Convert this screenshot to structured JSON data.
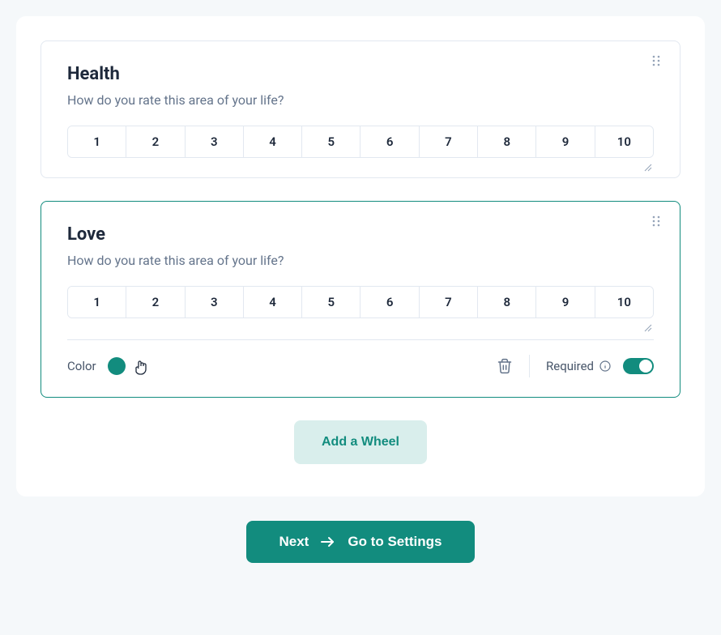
{
  "fields": [
    {
      "title": "Health",
      "subtitle": "How do you rate this area of your life?",
      "scale": [
        "1",
        "2",
        "3",
        "4",
        "5",
        "6",
        "7",
        "8",
        "9",
        "10"
      ],
      "active": false
    },
    {
      "title": "Love",
      "subtitle": "How do you rate this area of your life?",
      "scale": [
        "1",
        "2",
        "3",
        "4",
        "5",
        "6",
        "7",
        "8",
        "9",
        "10"
      ],
      "active": true,
      "color_label": "Color",
      "swatch_color": "#128c7e",
      "required_label": "Required",
      "required_on": true
    }
  ],
  "add_wheel_label": "Add a Wheel",
  "next_button": {
    "left": "Next",
    "right": "Go to Settings"
  },
  "colors": {
    "accent": "#128c7e",
    "accent_light": "#d9eeec"
  }
}
